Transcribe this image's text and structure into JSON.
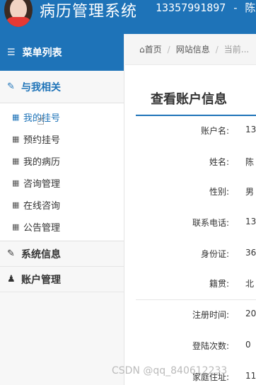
{
  "header": {
    "app_title": "病历管理系统",
    "user_info": "13357991897 - 陈"
  },
  "sidebar": {
    "menu_title": "菜单列表",
    "groups": [
      {
        "label": "与我相关",
        "items": [
          {
            "label": "我的挂号"
          },
          {
            "label": "预约挂号"
          },
          {
            "label": "我的病历"
          },
          {
            "label": "咨询管理"
          },
          {
            "label": "在线咨询"
          },
          {
            "label": "公告管理"
          }
        ]
      },
      {
        "label": "系统信息"
      },
      {
        "label": "账户管理"
      }
    ]
  },
  "breadcrumb": {
    "home": "首页",
    "site_info": "网站信息",
    "current": "当前..."
  },
  "panel": {
    "title": "查看账户信息"
  },
  "fields": [
    {
      "label": "账户名:",
      "value": "13"
    },
    {
      "label": "姓名:",
      "value": "陈"
    },
    {
      "label": "性别:",
      "value": "男"
    },
    {
      "label": "联系电话:",
      "value": "13"
    },
    {
      "label": "身份证:",
      "value": "36"
    },
    {
      "label": "籍贯:",
      "value": "北"
    },
    {
      "label": "注册时间:",
      "value": "20"
    },
    {
      "label": "登陆次数:",
      "value": "0"
    },
    {
      "label": "家庭住址:",
      "value": "11"
    }
  ],
  "watermark": "CSDN @qq_840612233",
  "colors": {
    "accent": "#1e73b8",
    "sidebar_bg": "#f7f7f7"
  }
}
